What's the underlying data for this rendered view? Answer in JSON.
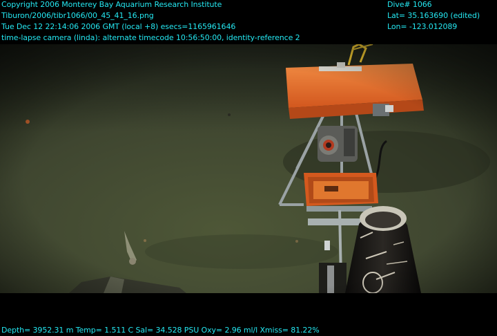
{
  "overlay": {
    "top_left": [
      "Copyright 2006 Monterey Bay Aquarium Research Institute",
      "Tiburon/2006/tibr1066/00_45_41_16.png",
      "Tue Dec 12 22:14:06 2006 GMT (local +8)  esecs=1165961646",
      "time-lapse camera (linda): alternate timecode 10:56:50:00, identity-reference 2"
    ],
    "top_right": [
      "Dive# 1066",
      "Lat= 35.163690 (edited)",
      "Lon= -123.012089"
    ],
    "bottom": "Depth= 3952.31 m  Temp= 1.511 C  Sal= 34.528 PSU  Oxy= 2.96 ml/l  Xmiss= 81.22%",
    "text_color": "#25e8f2"
  },
  "scene": {
    "seafloor_color": "#3f4630",
    "instrument_color": "#e2672a",
    "hose_color": "#1c1a18"
  }
}
